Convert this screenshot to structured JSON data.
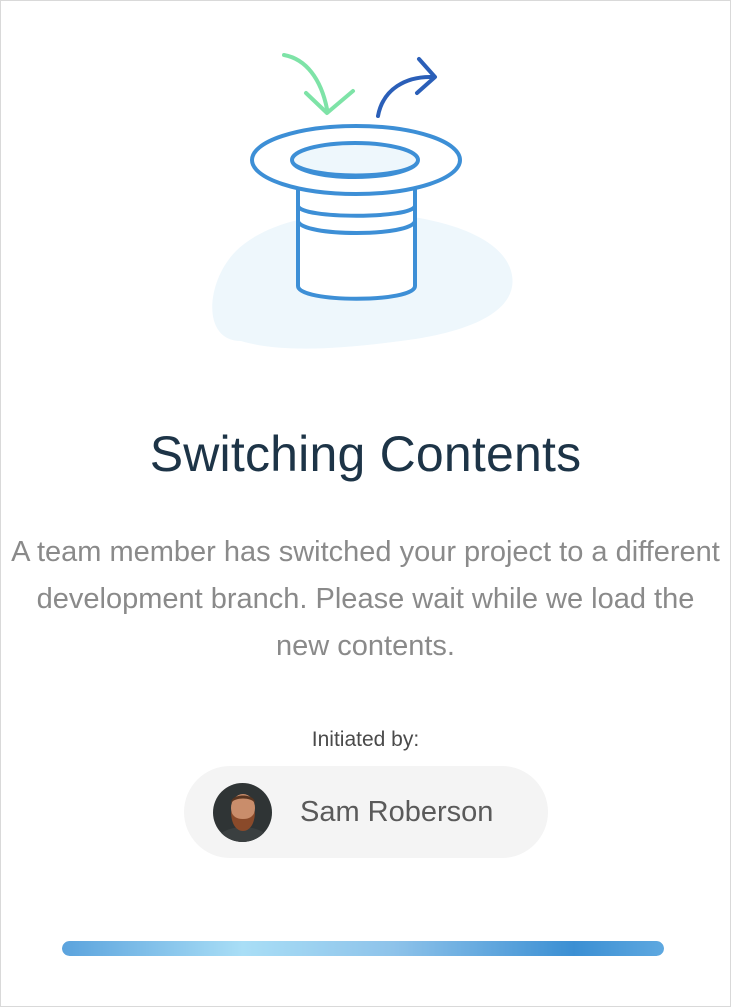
{
  "dialog": {
    "illustration_icon": "top-hat-switch-icon",
    "title": "Switching Contents",
    "description": "A team member has switched your project to a different development branch. Please wait while we load the new contents.",
    "initiated_label": "Initiated by:",
    "user": {
      "name": "Sam Roberson",
      "avatar_icon": "user-avatar-photo"
    },
    "progress": {
      "percent": 100
    }
  },
  "colors": {
    "title": "#1d3447",
    "description": "#8a8a8a",
    "hat_stroke": "#3d8fd6",
    "arrow_in": "#7ee3a7",
    "arrow_out": "#2b5fb8",
    "blob": "#eef7fc",
    "chip_bg": "#f4f4f4"
  }
}
